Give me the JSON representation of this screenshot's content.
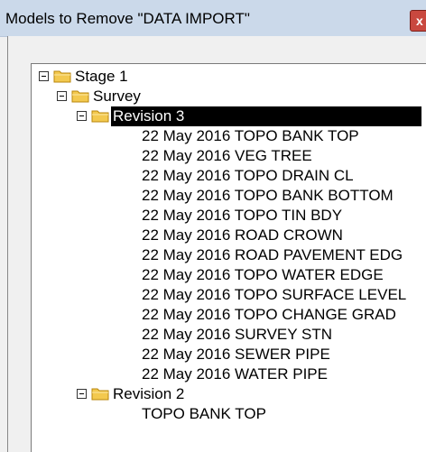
{
  "window": {
    "title": "Models to Remove \"DATA IMPORT\"",
    "close_label": "x"
  },
  "tree": {
    "stage": "Stage 1",
    "survey": "Survey",
    "revision3": "Revision 3",
    "revision3_items": [
      "22 May 2016 TOPO BANK TOP",
      "22 May 2016 VEG TREE",
      "22 May 2016 TOPO DRAIN CL",
      "22 May 2016 TOPO BANK BOTTOM",
      "22 May 2016 TOPO TIN BDY",
      "22 May 2016 ROAD CROWN",
      "22 May 2016 ROAD PAVEMENT EDG",
      "22 May 2016 TOPO WATER EDGE",
      "22 May 2016 TOPO SURFACE LEVEL",
      "22 May 2016 TOPO CHANGE GRAD",
      "22 May 2016 SURVEY STN",
      "22 May 2016 SEWER PIPE",
      "22 May 2016 WATER PIPE"
    ],
    "revision2": "Revision 2",
    "revision2_items": [
      "TOPO BANK TOP"
    ]
  },
  "colors": {
    "folder": "#f3c94f",
    "selection": "#000000"
  }
}
